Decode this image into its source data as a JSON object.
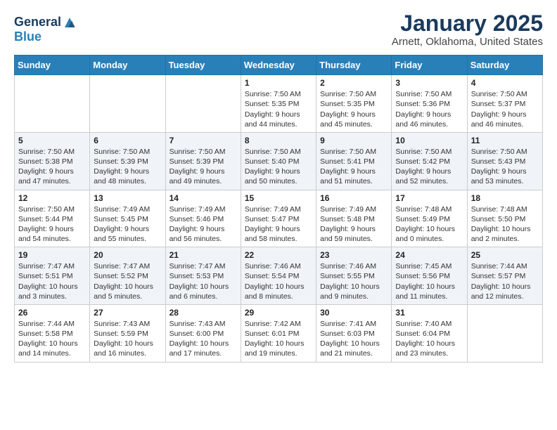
{
  "header": {
    "logo": {
      "general": "General",
      "blue": "Blue"
    },
    "month": "January 2025",
    "location": "Arnett, Oklahoma, United States"
  },
  "weekdays": [
    "Sunday",
    "Monday",
    "Tuesday",
    "Wednesday",
    "Thursday",
    "Friday",
    "Saturday"
  ],
  "weeks": [
    [
      {
        "day": "",
        "info": ""
      },
      {
        "day": "",
        "info": ""
      },
      {
        "day": "",
        "info": ""
      },
      {
        "day": "1",
        "info": "Sunrise: 7:50 AM\nSunset: 5:35 PM\nDaylight: 9 hours\nand 44 minutes."
      },
      {
        "day": "2",
        "info": "Sunrise: 7:50 AM\nSunset: 5:35 PM\nDaylight: 9 hours\nand 45 minutes."
      },
      {
        "day": "3",
        "info": "Sunrise: 7:50 AM\nSunset: 5:36 PM\nDaylight: 9 hours\nand 46 minutes."
      },
      {
        "day": "4",
        "info": "Sunrise: 7:50 AM\nSunset: 5:37 PM\nDaylight: 9 hours\nand 46 minutes."
      }
    ],
    [
      {
        "day": "5",
        "info": "Sunrise: 7:50 AM\nSunset: 5:38 PM\nDaylight: 9 hours\nand 47 minutes."
      },
      {
        "day": "6",
        "info": "Sunrise: 7:50 AM\nSunset: 5:39 PM\nDaylight: 9 hours\nand 48 minutes."
      },
      {
        "day": "7",
        "info": "Sunrise: 7:50 AM\nSunset: 5:39 PM\nDaylight: 9 hours\nand 49 minutes."
      },
      {
        "day": "8",
        "info": "Sunrise: 7:50 AM\nSunset: 5:40 PM\nDaylight: 9 hours\nand 50 minutes."
      },
      {
        "day": "9",
        "info": "Sunrise: 7:50 AM\nSunset: 5:41 PM\nDaylight: 9 hours\nand 51 minutes."
      },
      {
        "day": "10",
        "info": "Sunrise: 7:50 AM\nSunset: 5:42 PM\nDaylight: 9 hours\nand 52 minutes."
      },
      {
        "day": "11",
        "info": "Sunrise: 7:50 AM\nSunset: 5:43 PM\nDaylight: 9 hours\nand 53 minutes."
      }
    ],
    [
      {
        "day": "12",
        "info": "Sunrise: 7:50 AM\nSunset: 5:44 PM\nDaylight: 9 hours\nand 54 minutes."
      },
      {
        "day": "13",
        "info": "Sunrise: 7:49 AM\nSunset: 5:45 PM\nDaylight: 9 hours\nand 55 minutes."
      },
      {
        "day": "14",
        "info": "Sunrise: 7:49 AM\nSunset: 5:46 PM\nDaylight: 9 hours\nand 56 minutes."
      },
      {
        "day": "15",
        "info": "Sunrise: 7:49 AM\nSunset: 5:47 PM\nDaylight: 9 hours\nand 58 minutes."
      },
      {
        "day": "16",
        "info": "Sunrise: 7:49 AM\nSunset: 5:48 PM\nDaylight: 9 hours\nand 59 minutes."
      },
      {
        "day": "17",
        "info": "Sunrise: 7:48 AM\nSunset: 5:49 PM\nDaylight: 10 hours\nand 0 minutes."
      },
      {
        "day": "18",
        "info": "Sunrise: 7:48 AM\nSunset: 5:50 PM\nDaylight: 10 hours\nand 2 minutes."
      }
    ],
    [
      {
        "day": "19",
        "info": "Sunrise: 7:47 AM\nSunset: 5:51 PM\nDaylight: 10 hours\nand 3 minutes."
      },
      {
        "day": "20",
        "info": "Sunrise: 7:47 AM\nSunset: 5:52 PM\nDaylight: 10 hours\nand 5 minutes."
      },
      {
        "day": "21",
        "info": "Sunrise: 7:47 AM\nSunset: 5:53 PM\nDaylight: 10 hours\nand 6 minutes."
      },
      {
        "day": "22",
        "info": "Sunrise: 7:46 AM\nSunset: 5:54 PM\nDaylight: 10 hours\nand 8 minutes."
      },
      {
        "day": "23",
        "info": "Sunrise: 7:46 AM\nSunset: 5:55 PM\nDaylight: 10 hours\nand 9 minutes."
      },
      {
        "day": "24",
        "info": "Sunrise: 7:45 AM\nSunset: 5:56 PM\nDaylight: 10 hours\nand 11 minutes."
      },
      {
        "day": "25",
        "info": "Sunrise: 7:44 AM\nSunset: 5:57 PM\nDaylight: 10 hours\nand 12 minutes."
      }
    ],
    [
      {
        "day": "26",
        "info": "Sunrise: 7:44 AM\nSunset: 5:58 PM\nDaylight: 10 hours\nand 14 minutes."
      },
      {
        "day": "27",
        "info": "Sunrise: 7:43 AM\nSunset: 5:59 PM\nDaylight: 10 hours\nand 16 minutes."
      },
      {
        "day": "28",
        "info": "Sunrise: 7:43 AM\nSunset: 6:00 PM\nDaylight: 10 hours\nand 17 minutes."
      },
      {
        "day": "29",
        "info": "Sunrise: 7:42 AM\nSunset: 6:01 PM\nDaylight: 10 hours\nand 19 minutes."
      },
      {
        "day": "30",
        "info": "Sunrise: 7:41 AM\nSunset: 6:03 PM\nDaylight: 10 hours\nand 21 minutes."
      },
      {
        "day": "31",
        "info": "Sunrise: 7:40 AM\nSunset: 6:04 PM\nDaylight: 10 hours\nand 23 minutes."
      },
      {
        "day": "",
        "info": ""
      }
    ]
  ]
}
